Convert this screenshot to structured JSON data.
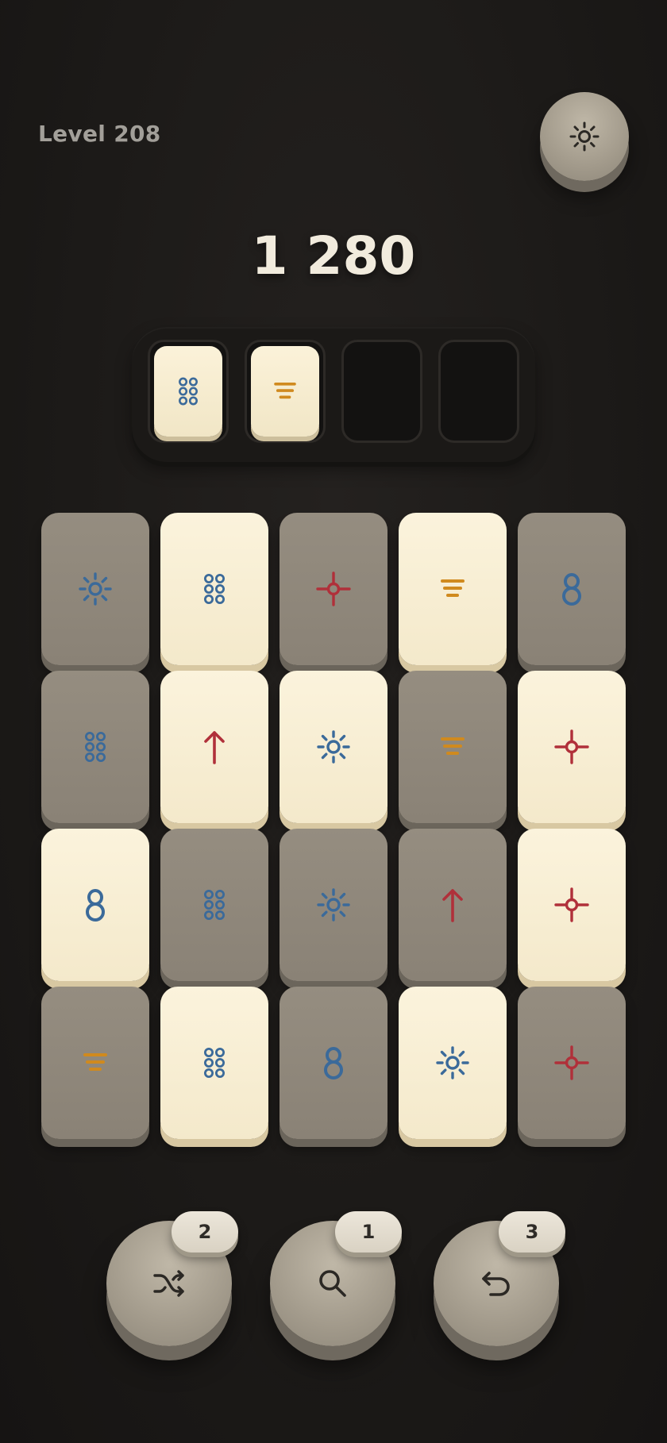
{
  "header": {
    "level_label": "Level 208",
    "settings_icon": "sun-icon"
  },
  "score": "1 280",
  "tray": {
    "slots": [
      {
        "filled": true,
        "symbol": "dots"
      },
      {
        "filled": true,
        "symbol": "stack"
      },
      {
        "filled": false
      },
      {
        "filled": false
      }
    ]
  },
  "board": {
    "rows": [
      [
        {
          "style": "gray",
          "symbol": "sun"
        },
        {
          "style": "cream",
          "symbol": "dots"
        },
        {
          "style": "gray",
          "symbol": "crosshair"
        },
        {
          "style": "cream",
          "symbol": "stack"
        },
        {
          "style": "gray",
          "symbol": "eight"
        }
      ],
      [
        {
          "style": "gray",
          "symbol": "dots"
        },
        {
          "style": "cream",
          "symbol": "arrow"
        },
        {
          "style": "cream",
          "symbol": "sun"
        },
        {
          "style": "gray",
          "symbol": "stack"
        },
        {
          "style": "cream",
          "symbol": "crosshair"
        }
      ],
      [
        {
          "style": "cream",
          "symbol": "eight"
        },
        {
          "style": "gray",
          "symbol": "dots"
        },
        {
          "style": "gray",
          "symbol": "sun"
        },
        {
          "style": "gray",
          "symbol": "arrow"
        },
        {
          "style": "cream",
          "symbol": "crosshair"
        }
      ],
      [
        {
          "style": "gray",
          "symbol": "stack"
        },
        {
          "style": "cream",
          "symbol": "dots"
        },
        {
          "style": "gray",
          "symbol": "eight"
        },
        {
          "style": "cream",
          "symbol": "sun"
        },
        {
          "style": "gray",
          "symbol": "crosshair"
        }
      ]
    ]
  },
  "tools": [
    {
      "name": "shuffle",
      "icon": "shuffle-icon",
      "count": "2"
    },
    {
      "name": "hint",
      "icon": "magnifier-icon",
      "count": "1"
    },
    {
      "name": "undo",
      "icon": "undo-icon",
      "count": "3"
    }
  ],
  "colors": {
    "blue": "#3b6a9a",
    "red": "#b0303a",
    "orange": "#d08a1e",
    "dark_icon": "#2b2824"
  }
}
